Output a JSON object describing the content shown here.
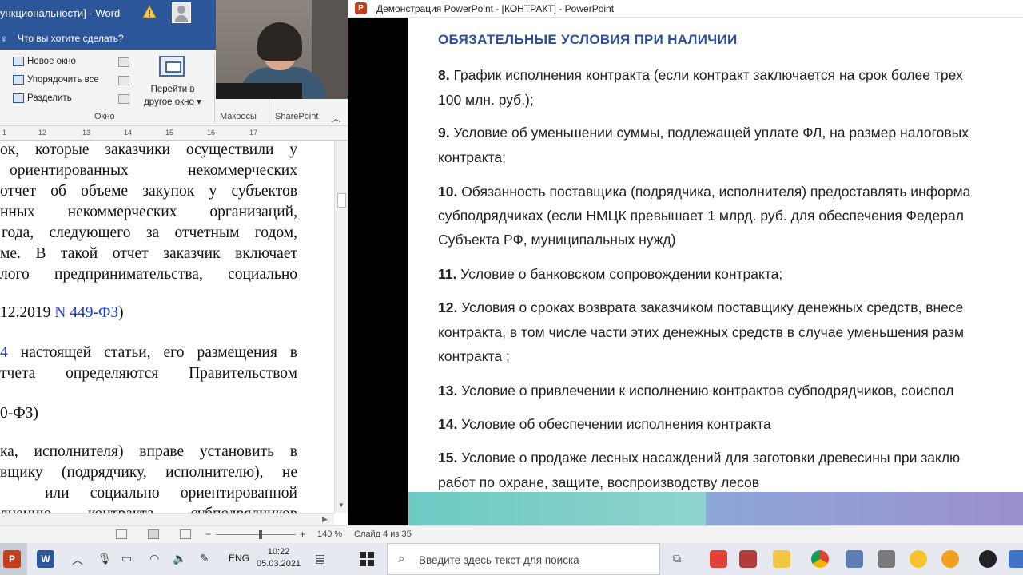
{
  "word": {
    "title": "ункциональности] - Word",
    "tell_me": "Что вы хотите сделать?",
    "ribbon": {
      "new_window": "Новое окно",
      "arrange_all": "Упорядочить все",
      "split": "Разделить",
      "goto_line1": "Перейти в",
      "goto_line2": "другое окно",
      "group_window": "Окно",
      "group_macros": "Макросы",
      "group_sharepoint": "SharePoint"
    },
    "ruler_ticks": [
      "1",
      "12",
      "13",
      "14",
      "15",
      "16",
      "17"
    ],
    "doc_lines": [
      "ок, которые заказчики осуществили у",
      "ориентированных некоммерческих",
      "отчет об объеме закупок у субъектов",
      "нных некоммерческих организаций,",
      "года, следующего за отчетным годом,",
      "ме. В такой отчет заказчик включает",
      "лого предпринимательства, социально",
      "12.2019 ",
      "N 449-ФЗ",
      ")",
      "4",
      " настоящей статьи, его размещения в",
      "тчета определяются Правительством",
      "0-ФЗ)",
      "ка, исполнителя) вправе установить в",
      "вщику (подрядчику, исполнителю), не",
      "или социально ориентированной",
      "лнению контракта субподрядчиков"
    ],
    "zoom": "140 %"
  },
  "ppt": {
    "title": "Демонстрация PowerPoint - [КОНТРАКТ] - PowerPoint",
    "slide_heading": "ОБЯЗАТЕЛЬНЫЕ УСЛОВИЯ ПРИ НАЛИЧИИ",
    "items": [
      {
        "num": "8.",
        "text": " График исполнения контракта (если  контракт заключается на срок более трех"
      },
      {
        "num": "",
        "text": "100 млн. руб.);"
      },
      {
        "num": "9.",
        "text": " Условие об уменьшении суммы, подлежащей уплате ФЛ, на размер налоговых"
      },
      {
        "num": "",
        "text": "контракта;"
      },
      {
        "num": "10.",
        "text": " Обязанность поставщика (подрядчика, исполнителя) предоставлять информа"
      },
      {
        "num": "",
        "text": "субподрядчиках (если НМЦК превышает 1 млрд. руб. для обеспечения Федерал"
      },
      {
        "num": "",
        "text": "Субъекта РФ, муниципальных нужд)"
      },
      {
        "num": "11.",
        "text": " Условие о банковском сопровождении контракта;"
      },
      {
        "num": "12.",
        "text": " Условия о сроках возврата заказчиком поставщику денежных средств, внесе"
      },
      {
        "num": "",
        "text": "контракта, в том числе части этих денежных средств в случае уменьшения разм"
      },
      {
        "num": "",
        "text": "контракта ;"
      },
      {
        "num": "13.",
        "text": " Условие о привлечении к исполнению контрактов субподрядчиков, соиспол"
      },
      {
        "num": "14.",
        "text": " Условие об обеспечении исполнения контракта"
      },
      {
        "num": "15.",
        "text": " Условие о продаже лесных насаждений для заготовки древесины при заклю"
      },
      {
        "num": "",
        "text": "работ по охране, защите, воспроизводству лесов"
      }
    ],
    "slide_counter": "Слайд 4 из 35"
  },
  "taskbar": {
    "lang": "ENG",
    "time": "10:22",
    "date": "05.03.2021",
    "search_placeholder": "Введите здесь текст для поиска"
  },
  "colors": {
    "word_blue": "#2b579a",
    "ppt_heading": "#2e4f9b",
    "link_blue": "#1f3fc4"
  }
}
